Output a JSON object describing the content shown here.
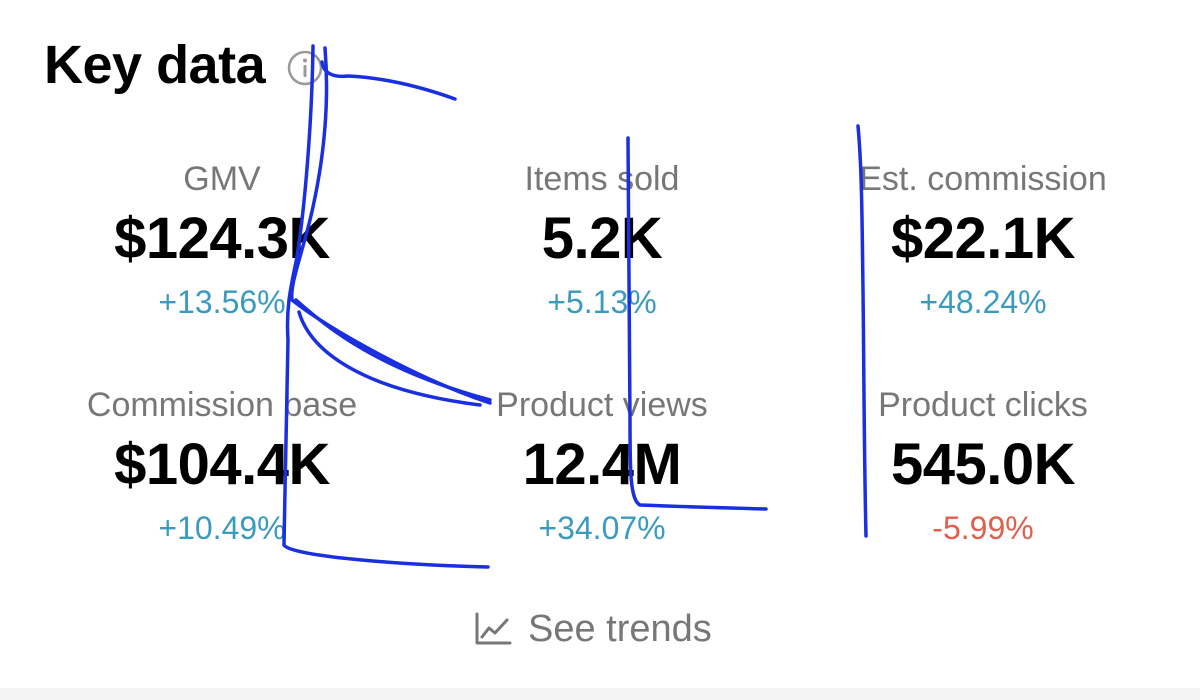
{
  "section": {
    "title": "Key data",
    "info_icon": "info-circle-icon"
  },
  "metrics": [
    {
      "label": "GMV",
      "value": "$124.3K",
      "change": "+13.56%",
      "trend": "up"
    },
    {
      "label": "Items sold",
      "value": "5.2K",
      "change": "+5.13%",
      "trend": "up"
    },
    {
      "label": "Est. commission",
      "value": "$22.1K",
      "change": "+48.24%",
      "trend": "up"
    },
    {
      "label": "Commission base",
      "value": "$104.4K",
      "change": "+10.49%",
      "trend": "up"
    },
    {
      "label": "Product views",
      "value": "12.4M",
      "change": "+34.07%",
      "trend": "up"
    },
    {
      "label": "Product clicks",
      "value": "545.0K",
      "change": "-5.99%",
      "trend": "down"
    }
  ],
  "see_trends": {
    "label": "See trends",
    "icon": "line-chart-icon"
  },
  "colors": {
    "positive": "#3a9bbf",
    "negative": "#e0604e",
    "label": "#777777",
    "value": "#000000",
    "annotation_ink": "#1a2fe0"
  }
}
